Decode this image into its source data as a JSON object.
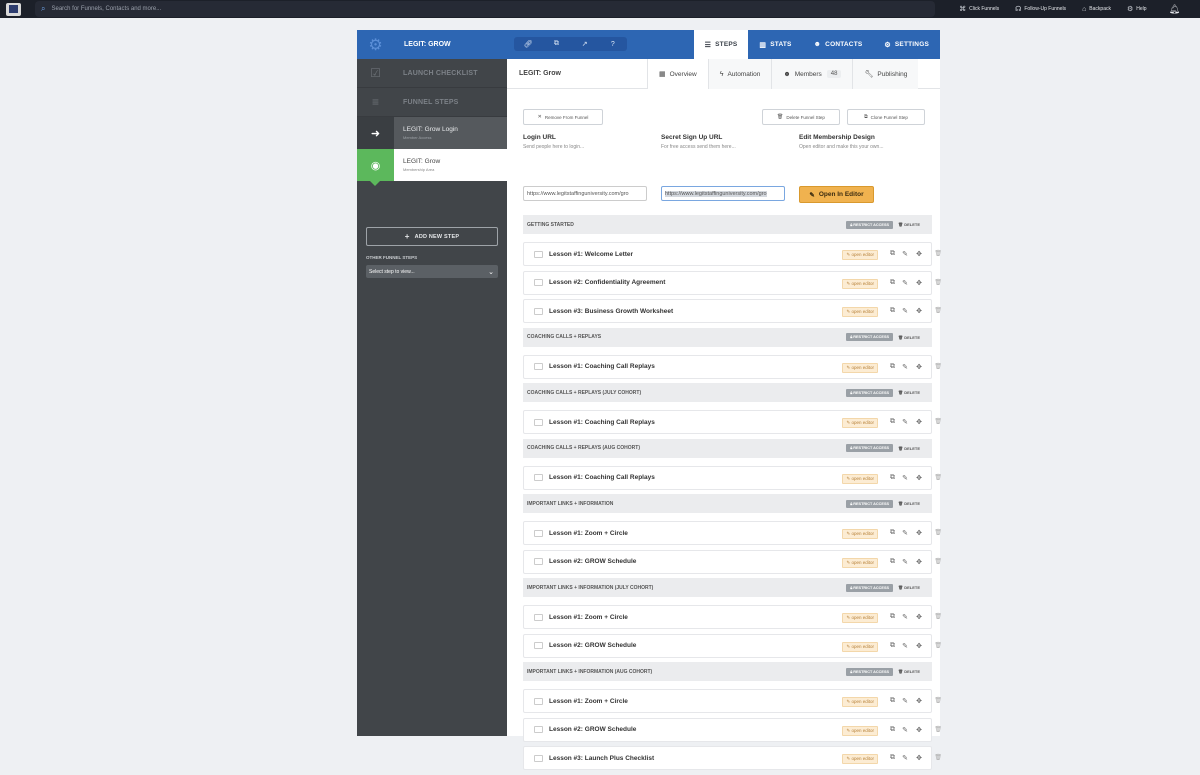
{
  "topbar": {
    "search_placeholder": "Search for Funnels, Contacts and more...",
    "nav": [
      {
        "label": "Click Funnels",
        "icon": "clickfunnels-icon",
        "glyph": "⌘"
      },
      {
        "label": "Follow-Up Funnels",
        "icon": "followup-icon",
        "glyph": "☊"
      },
      {
        "label": "Backpack",
        "icon": "backpack-icon",
        "glyph": "⌂"
      },
      {
        "label": "Help",
        "icon": "help-gear-icon",
        "glyph": "⚙"
      }
    ]
  },
  "header": {
    "funnel_name": "LEGIT: GROW",
    "tabs": [
      {
        "label": "STEPS",
        "icon": "steps-icon",
        "glyph": "☰"
      },
      {
        "label": "STATS",
        "icon": "stats-icon",
        "glyph": "▥"
      },
      {
        "label": "CONTACTS",
        "icon": "contacts-icon",
        "glyph": "☻"
      },
      {
        "label": "SETTINGS",
        "icon": "settings-icon",
        "glyph": "⚙"
      }
    ]
  },
  "sidebar": {
    "launch_checklist": "LAUNCH CHECKLIST",
    "funnel_steps": "FUNNEL STEPS",
    "steps": [
      {
        "title": "LEGIT: Grow Login",
        "sub": "Member Access",
        "icon": "login-icon",
        "glyph": "➜"
      },
      {
        "title": "LEGIT: Grow",
        "sub": "Membership Area",
        "icon": "dashboard-icon",
        "glyph": "◉"
      }
    ],
    "add_step": "ADD NEW STEP",
    "other_label": "OTHER FUNNEL STEPS",
    "select_value": "Select step to view..."
  },
  "main": {
    "title": "LEGIT: Grow",
    "tabs": {
      "overview": "Overview",
      "automation": "Automation",
      "members": "Members",
      "members_count": "48",
      "publishing": "Publishing"
    },
    "remove": "Remove From Funnel",
    "delete_step": "Delete Funnel Step",
    "clone_step": "Clone Funnel Step",
    "login_url_label": "Login URL",
    "login_url_desc": "Send people here to login...",
    "login_url_value": "https://www.legitstaffinguniversity.com/gro",
    "signup_label": "Secret Sign Up URL",
    "signup_desc": "For free access send them here...",
    "signup_value": "https://www.legitstaffinguniversity.com/gro",
    "design_label": "Edit Membership Design",
    "design_desc": "Open editor and make this your own...",
    "open_editor": "Open In Editor",
    "restrict": "RESTRICT ACCESS",
    "delete": "DELETE",
    "open_editor_small": "open editor"
  },
  "sections": [
    {
      "title": "GETTING STARTED",
      "lessons": [
        "Lesson #1: Welcome Letter",
        "Lesson #2: Confidentiality Agreement",
        "Lesson #3: Business Growth Worksheet"
      ]
    },
    {
      "title": "COACHING CALLS + REPLAYS",
      "lessons": [
        "Lesson #1: Coaching Call Replays"
      ]
    },
    {
      "title": "COACHING CALLS + REPLAYS (JULY COHORT)",
      "lessons": [
        "Lesson #1: Coaching Call Replays"
      ]
    },
    {
      "title": "COACHING CALLS + REPLAYS (AUG COHORT)",
      "lessons": [
        "Lesson #1: Coaching Call Replays"
      ]
    },
    {
      "title": "IMPORTANT LINKS + INFORMATION",
      "lessons": [
        "Lesson #1: Zoom + Circle",
        "Lesson #2: GROW Schedule"
      ]
    },
    {
      "title": "IMPORTANT LINKS + INFORMATION (JULY COHORT)",
      "lessons": [
        "Lesson #1: Zoom + Circle",
        "Lesson #2: GROW Schedule"
      ]
    },
    {
      "title": "IMPORTANT LINKS + INFORMATION (AUG COHORT)",
      "lessons": [
        "Lesson #1: Zoom + Circle",
        "Lesson #2: GROW Schedule",
        "Lesson #3: Launch Plus Checklist"
      ]
    }
  ],
  "colors": {
    "brand_blue": "#2d66b3",
    "accent_green": "#5cb85c",
    "editor_orange": "#f0b24f"
  }
}
